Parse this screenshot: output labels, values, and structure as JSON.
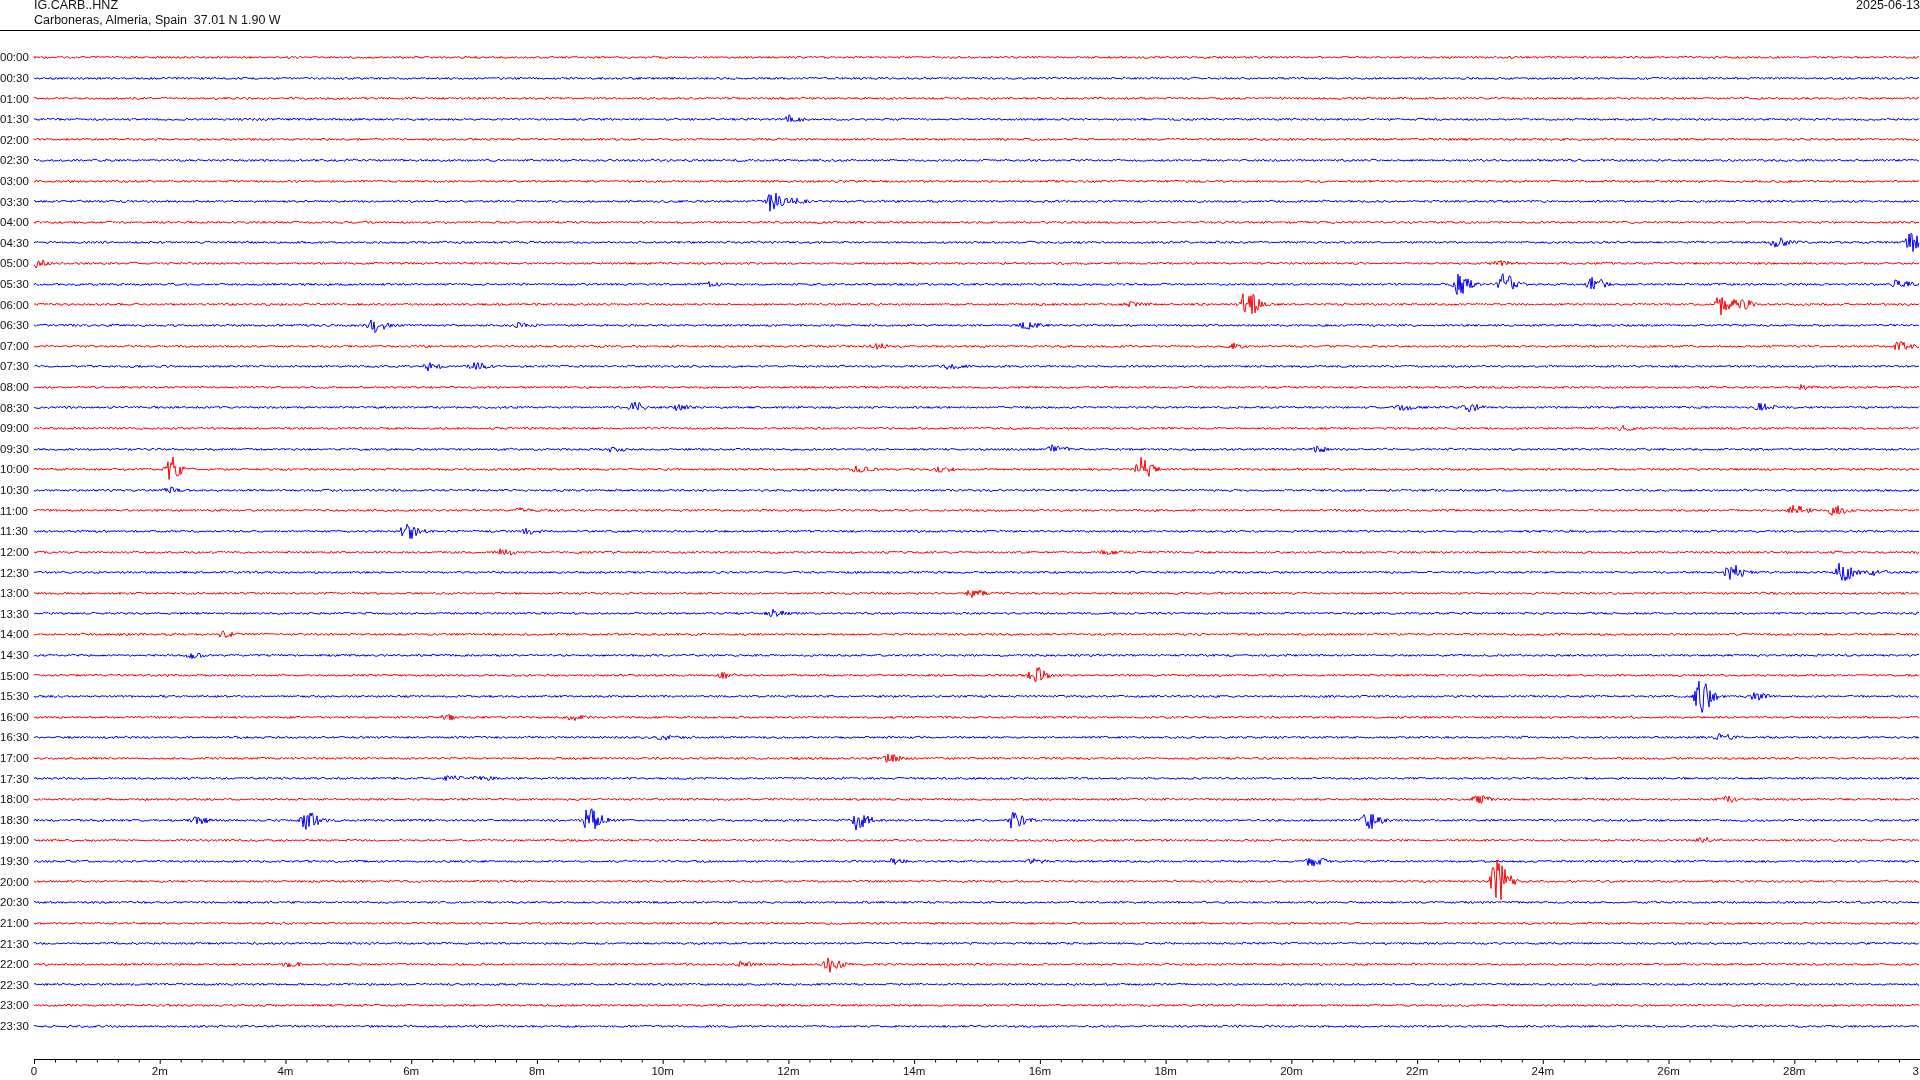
{
  "header": {
    "station": "IG.CARB..HNZ",
    "location": "Carboneras, Almeria, Spain  37.01 N 1.90 W",
    "date": "2025-06-13"
  },
  "traces": [
    {
      "time": "00:00",
      "color": "#ff0000"
    },
    {
      "time": "00:30",
      "color": "#0000ff"
    },
    {
      "time": "01:00",
      "color": "#ff0000"
    },
    {
      "time": "01:30",
      "color": "#0000ff"
    },
    {
      "time": "02:00",
      "color": "#ff0000"
    },
    {
      "time": "02:30",
      "color": "#0000ff"
    },
    {
      "time": "03:00",
      "color": "#ff0000"
    },
    {
      "time": "03:30",
      "color": "#0000ff"
    },
    {
      "time": "04:00",
      "color": "#ff0000"
    },
    {
      "time": "04:30",
      "color": "#0000ff"
    },
    {
      "time": "05:00",
      "color": "#ff0000"
    },
    {
      "time": "05:30",
      "color": "#0000ff"
    },
    {
      "time": "06:00",
      "color": "#ff0000"
    },
    {
      "time": "06:30",
      "color": "#0000ff"
    },
    {
      "time": "07:00",
      "color": "#ff0000"
    },
    {
      "time": "07:30",
      "color": "#0000ff"
    },
    {
      "time": "08:00",
      "color": "#ff0000"
    },
    {
      "time": "08:30",
      "color": "#0000ff"
    },
    {
      "time": "09:00",
      "color": "#ff0000"
    },
    {
      "time": "09:30",
      "color": "#0000ff"
    },
    {
      "time": "10:00",
      "color": "#ff0000"
    },
    {
      "time": "10:30",
      "color": "#0000ff"
    },
    {
      "time": "11:00",
      "color": "#ff0000"
    },
    {
      "time": "11:30",
      "color": "#0000ff"
    },
    {
      "time": "12:00",
      "color": "#ff0000"
    },
    {
      "time": "12:30",
      "color": "#0000ff"
    },
    {
      "time": "13:00",
      "color": "#ff0000"
    },
    {
      "time": "13:30",
      "color": "#0000ff"
    },
    {
      "time": "14:00",
      "color": "#ff0000"
    },
    {
      "time": "14:30",
      "color": "#0000ff"
    },
    {
      "time": "15:00",
      "color": "#ff0000"
    },
    {
      "time": "15:30",
      "color": "#0000ff"
    },
    {
      "time": "16:00",
      "color": "#ff0000"
    },
    {
      "time": "16:30",
      "color": "#0000ff"
    },
    {
      "time": "17:00",
      "color": "#ff0000"
    },
    {
      "time": "17:30",
      "color": "#0000ff"
    },
    {
      "time": "18:00",
      "color": "#ff0000"
    },
    {
      "time": "18:30",
      "color": "#0000ff"
    },
    {
      "time": "19:00",
      "color": "#ff0000"
    },
    {
      "time": "19:30",
      "color": "#0000ff"
    },
    {
      "time": "20:00",
      "color": "#ff0000"
    },
    {
      "time": "20:30",
      "color": "#0000ff"
    },
    {
      "time": "21:00",
      "color": "#ff0000"
    },
    {
      "time": "21:30",
      "color": "#0000ff"
    },
    {
      "time": "22:00",
      "color": "#ff0000"
    },
    {
      "time": "22:30",
      "color": "#0000ff"
    },
    {
      "time": "23:00",
      "color": "#ff0000"
    },
    {
      "time": "23:30",
      "color": "#0000ff"
    }
  ],
  "time_axis": {
    "labels": [
      "0",
      "2m",
      "4m",
      "6m",
      "8m",
      "10m",
      "12m",
      "14m",
      "16m",
      "18m",
      "20m",
      "22m",
      "24m",
      "26m",
      "28m",
      "3"
    ]
  }
}
